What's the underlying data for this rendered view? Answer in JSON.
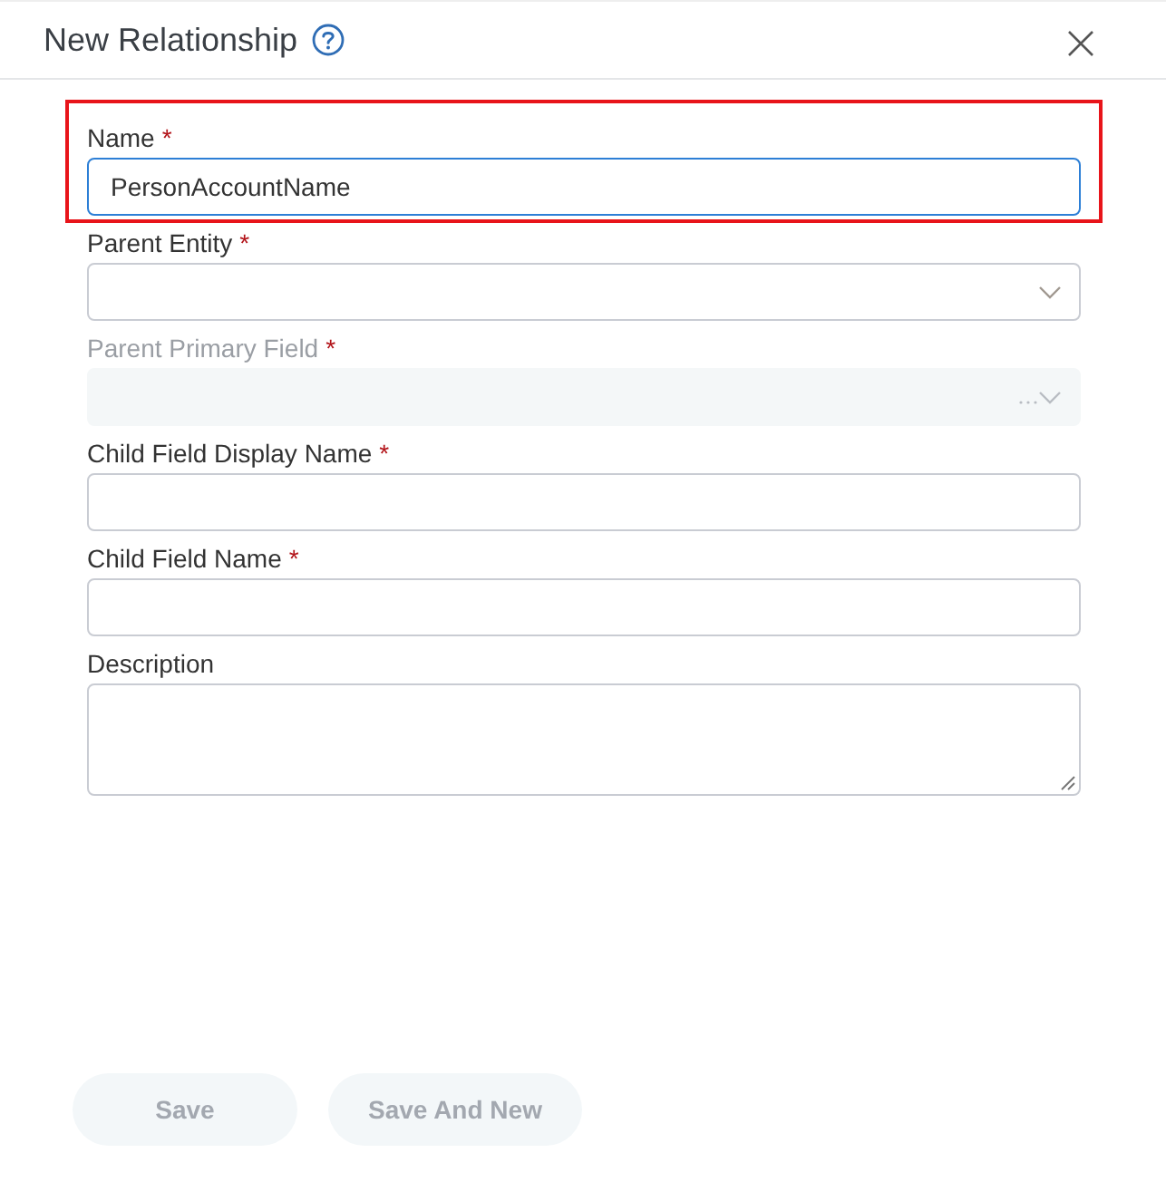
{
  "dialog": {
    "title": "New Relationship"
  },
  "fields": [
    {
      "kind": "input",
      "label": "Name",
      "required_mark": "*",
      "value": "PersonAccountName",
      "focused": true,
      "disabled": false,
      "highlighted": true
    },
    {
      "kind": "select",
      "label": "Parent Entity",
      "required_mark": "*",
      "focused": false,
      "disabled": false,
      "highlighted": false
    },
    {
      "kind": "select",
      "label": "Parent Primary Field",
      "required_mark": "*",
      "focused": false,
      "disabled": true,
      "highlighted": false
    },
    {
      "kind": "input",
      "label": "Child Field Display Name",
      "required_mark": "*",
      "focused": false,
      "disabled": false,
      "highlighted": false
    },
    {
      "kind": "input",
      "label": "Child Field Name",
      "required_mark": "*",
      "focused": false,
      "disabled": false,
      "highlighted": false
    },
    {
      "kind": "textarea",
      "label": "Description",
      "focused": false,
      "disabled": false,
      "highlighted": false
    }
  ],
  "buttons": [
    {
      "label": "Save",
      "disabled": true
    },
    {
      "label": "Save And New",
      "disabled": true
    }
  ]
}
